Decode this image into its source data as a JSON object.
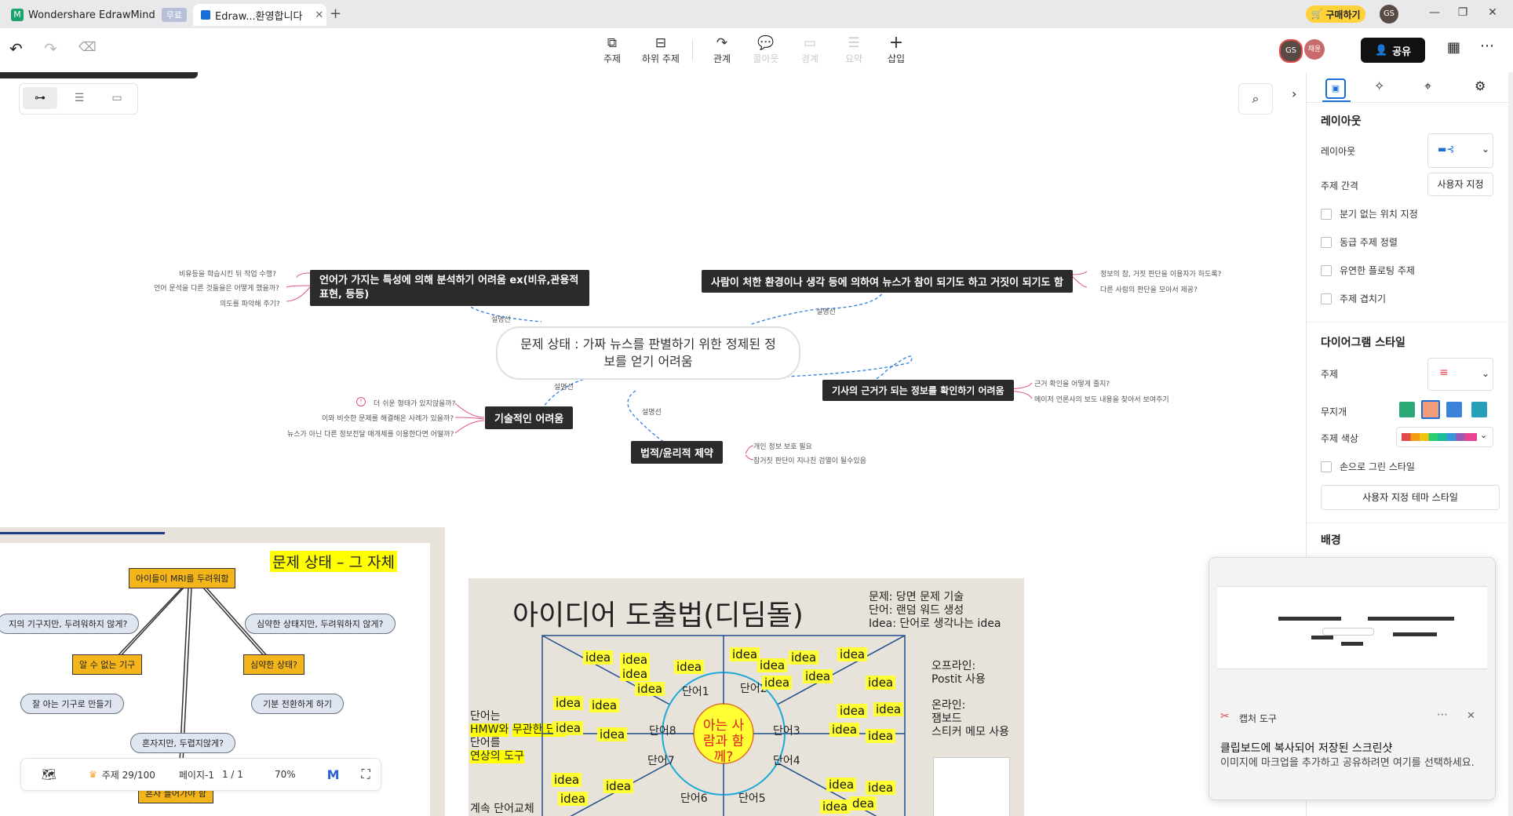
{
  "titlebar": {
    "app_tab": "Wondershare EdrawMind",
    "app_badge": "무료",
    "doc_tab": "Edraw...환영합니다",
    "buy_label": "구매하기",
    "user_initials": "GS"
  },
  "toolbar": {
    "tools": [
      {
        "label": "주제",
        "icon": "topic-icon",
        "enabled": true
      },
      {
        "label": "하위 주제",
        "icon": "subtopic-icon",
        "enabled": true
      },
      {
        "label": "관계",
        "icon": "relation-icon",
        "enabled": true
      },
      {
        "label": "콜아웃",
        "icon": "callout-icon",
        "enabled": false
      },
      {
        "label": "경계",
        "icon": "boundary-icon",
        "enabled": false
      },
      {
        "label": "요약",
        "icon": "summary-icon",
        "enabled": false
      },
      {
        "label": "삽입",
        "icon": "insert-icon",
        "enabled": true
      }
    ],
    "avatar_label": "GS",
    "avatar2_label": "채윤",
    "share_label": "공유"
  },
  "mindmap": {
    "root": "문제 상태 : 가짜 뉴스를 판별하기 위한 정제된 정보를 얻기 어려움",
    "relation_label": "설명선",
    "nodes": {
      "lang": "언어가 가지는 특성에 의해 분석하기 어려움 ex(비유,관용적 표현, 등등)",
      "env": "사람이 처한 환경이나 생각 등에 의하여 뉴스가 참이 되기도 하고 거짓이 되기도 함",
      "tech": "기술적인 어려움",
      "legal": "법적/윤리적 제약",
      "source": "기사의 근거가 되는 정보를 확인하기 어려움"
    },
    "leaves": {
      "lang": [
        "비유등을 학습시킨 뒤  작업 수행?",
        "언어 문석을 다른 것들을은 어떻게 했을까?",
        "의도를 파악해 주기?"
      ],
      "env": [
        "정보의 참, 거짓 판단을 이용자가 하도록?",
        "다른 사람의 판단을 모아서 제공?"
      ],
      "tech": [
        "더 쉬운 형태가 있지않을까?",
        "이와 비슷한 문제를 해결해온 사례가 있을까?",
        "뉴스가 아닌 다른 정보전달 매개체를 이용한다면 어떨까?"
      ],
      "legal": [
        "개인 정보 보호 필요",
        "참거짓 판단이 지나친 검열이 될수있음"
      ],
      "source": [
        "근거 확인을 어떻게 줄지?",
        "메이저 언론사의 보도 내용을 찾아서 보여주기"
      ]
    }
  },
  "slide_left": {
    "title": "문제 상태 – 그 자체",
    "center_box": "아이들이 MRI를 두려워함",
    "clouds": [
      "지의 기구지만, 두려워하지 않게?",
      "심약한 상태지만, 두려워하지 않게?",
      "잘 아는 기구로 만들기",
      "기분 전환하게 하기",
      "혼자지만, 두렵지않게?"
    ],
    "boxes": [
      "알 수 없는 기구",
      "심약한 상태?",
      "혼자 들어가야 함"
    ]
  },
  "slide_right": {
    "title": "아이디어 도출법(디딤돌)",
    "notes": [
      "문제: 당면 문제 기술",
      "단어: 랜덤 워드 생성",
      "Idea: 단어로 생각나는 idea"
    ],
    "offline": [
      "오프라인:",
      "Postit 사용"
    ],
    "online": [
      "온라인:",
      "잼보드",
      "스티커 메모 사용"
    ],
    "left_text": [
      "단어는",
      "HMW와",
      "무관한 단어",
      "단어를",
      "연상의 도구"
    ],
    "bottom_text": "계속 단어교체",
    "center": "아는 사람과 함께?",
    "words": [
      "단어1",
      "단어2",
      "단어3",
      "단어4",
      "단어5",
      "단어6",
      "단어7",
      "단어8"
    ],
    "idea": "idea",
    "dea": "dea"
  },
  "bottombar": {
    "topic_count": "주제 29/100",
    "page": "페이지-1",
    "page_of": "1 / 1",
    "zoom": "70%"
  },
  "panel": {
    "section_layout": "레이아웃",
    "layout_label": "레이아웃",
    "spacing_label": "주제 간격",
    "spacing_value": "사용자 지정",
    "checks": [
      "분기 없는 위치 지정",
      "동급 주제 정렬",
      "유연한 플로팅 주제",
      "주제 겹치기"
    ],
    "section_style": "다이어그램 스타일",
    "topic_label": "주제",
    "rainbow_label": "무지개",
    "topic_color_label": "주제 색상",
    "hand_drawn": "손으로 그린 스타일",
    "custom_theme": "사용자 지정 테마 스타일",
    "section_bg": "배경"
  },
  "notification": {
    "app": "캡처 도구",
    "title": "클립보드에 복사되어 저장된 스크린샷",
    "body": "이미지에 마크업을 추가하고 공유하려면 여기를 선택하세요."
  },
  "colors": {
    "accent": "#1a6fd6",
    "dark_node": "#2b2b2b",
    "relation": "#2f7de1",
    "leaf_line": "#e0557a",
    "buy": "#ffd23a",
    "sticky": "#ffff33"
  }
}
